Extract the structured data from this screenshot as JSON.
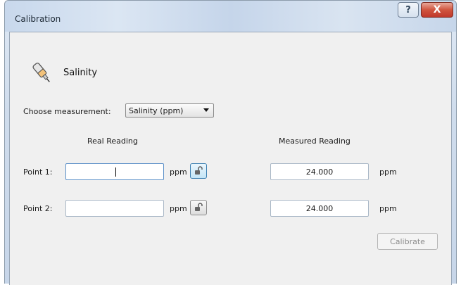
{
  "window": {
    "title": "Calibration",
    "help_label": "?",
    "close_label": "X"
  },
  "header": {
    "icon": "salinity-probe-icon",
    "label": "Salinity"
  },
  "measurement": {
    "label": "Choose measurement:",
    "selected": "Salinity (ppm)"
  },
  "columns": {
    "real": "Real Reading",
    "measured": "Measured Reading"
  },
  "points": [
    {
      "label": "Point 1:",
      "real_value": "",
      "real_unit": "ppm",
      "lock_icon": "unlock-icon",
      "measured_value": "24.000",
      "measured_unit": "ppm"
    },
    {
      "label": "Point 2:",
      "real_value": "",
      "real_unit": "ppm",
      "lock_icon": "unlock-icon",
      "measured_value": "24.000",
      "measured_unit": "ppm"
    }
  ],
  "actions": {
    "calibrate_label": "Calibrate"
  },
  "colors": {
    "close_button": "#c0392b",
    "focus_border": "#5a8fc8",
    "disabled_text": "#8d8d8d"
  }
}
